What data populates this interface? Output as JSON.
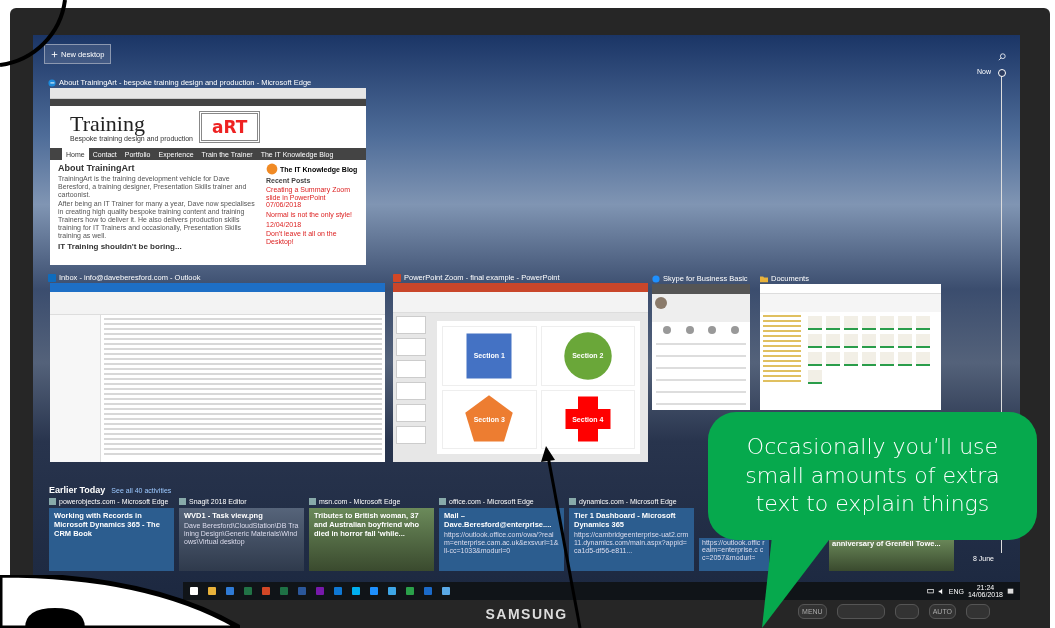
{
  "new_desktop": {
    "label": "New desktop"
  },
  "edge_window": {
    "title": "About TrainingArt - bespoke training design and production - Microsoft Edge",
    "logo_word": "Training",
    "logo_art": "aRT",
    "tagline": "Bespoke training design and production",
    "nav": [
      {
        "label": "Home",
        "selected": true
      },
      {
        "label": "Contact",
        "selected": false
      },
      {
        "label": "Portfolio",
        "selected": false
      },
      {
        "label": "Experience",
        "selected": false
      },
      {
        "label": "Train the Trainer",
        "selected": false
      },
      {
        "label": "The IT Knowledge Blog",
        "selected": false
      }
    ],
    "heading": "About TrainingArt",
    "paragraphs": [
      "TrainingArt is the training development vehicle for Dave Beresford, a training designer, Presentation Skills trainer and cartoonist.",
      "After being an IT Trainer for many a year, Dave now specialises in creating high quality bespoke training content and training Trainers how to deliver it. He also delivers production skills training for IT Trainers and occasionally, Presentation Skills training as well."
    ],
    "subheading": "IT Training shouldn't be boring...",
    "blog_title": "The IT Knowledge Blog",
    "recent_heading": "Recent Posts",
    "posts": [
      "Creating a Summary Zoom slide in PowerPoint 07/06/2018",
      "Normal is not the only style!",
      "12/04/2018",
      "Don't leave it all on the Desktop!"
    ]
  },
  "outlook_window": {
    "title": "Inbox - info@daveberesford.com - Outlook"
  },
  "powerpoint_window": {
    "title": "PowerPoint Zoom - final example - PowerPoint",
    "sections": [
      {
        "label": "Section 1",
        "kind": "square",
        "color": "#4472c4"
      },
      {
        "label": "Section 2",
        "kind": "circle",
        "color": "#6aa739"
      },
      {
        "label": "Section 3",
        "kind": "pentagon",
        "color": "#ed7d31"
      },
      {
        "label": "Section 4",
        "kind": "cross",
        "color": "#ff0000"
      }
    ]
  },
  "skype_window": {
    "title": "Skype for Business Basic"
  },
  "explorer_window": {
    "title": "Documents"
  },
  "activities": {
    "heading": "Earlier Today",
    "link": "See all 40 activities",
    "cards": [
      {
        "kind": "text",
        "app": "powerobjects.com - Microsoft Edge",
        "title": "Working with Records in Microsoft Dynamics 365 - The CRM Book"
      },
      {
        "kind": "screenshot",
        "app": "Snagit 2018 Editor",
        "title": "WVD1 - Task view.png",
        "detail": "Dave Beresford\\CloudStation\\DB Training Design\\Generic Materials\\Windows\\Virtual desktop"
      },
      {
        "kind": "photo",
        "app": "msn.com - Microsoft Edge",
        "title": "Tributes to British woman, 37 and Australian boyfriend who died in horror fall ‘while..."
      },
      {
        "kind": "text",
        "app": "office.com - Microsoft Edge",
        "title": "Mail – Dave.Beresford@enterprise....",
        "detail": "https://outlook.office.com/owa/?realm=enterprise.cam.ac.uk&exsvurl=1&ll-cc=1033&modurl=0"
      },
      {
        "kind": "text",
        "app": "dynamics.com - Microsoft Edge",
        "title": "Tier 1 Dashboard - Microsoft Dynamics 365",
        "detail": "https://cambridgeenterprise-uat2.crm11.dynamics.com/main.aspx?appid=ca1d5-df56-e811..."
      },
      {
        "kind": "text",
        "detail": "https://outlook.offic realm=enterprise.c cc=2057&modurl="
      },
      {
        "kind": "photo",
        "title": "anniversary of Grenfell Towe..."
      }
    ]
  },
  "timeline": {
    "now": "Now",
    "end": "8 June"
  },
  "tray": {
    "language": "ENG",
    "time": "21:24",
    "date": "14/06/2018"
  },
  "callout": "Occasionally you’ll use small amounts of extra text to explain things",
  "monitor": {
    "brand": "SAMSUNG",
    "buttons": [
      "MENU",
      "AUTO"
    ]
  }
}
